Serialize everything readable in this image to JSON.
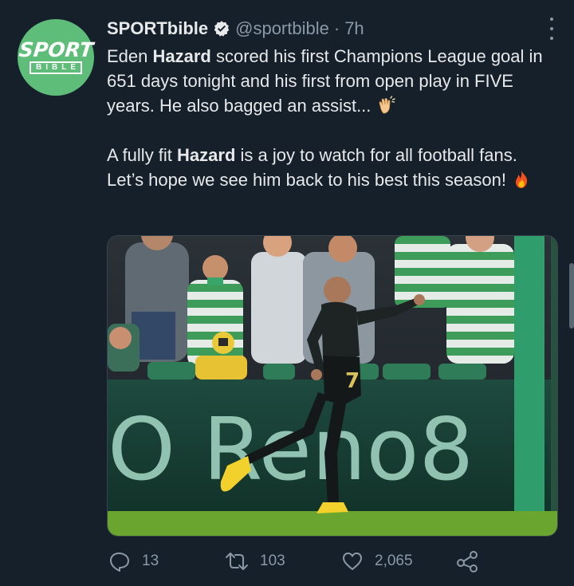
{
  "account": {
    "avatar_text_top": "SPORT",
    "avatar_text_bottom": "BIBLE",
    "name": "SPORTbible",
    "handle": "@sportbible",
    "separator": "·",
    "time": "7h"
  },
  "tweet": {
    "line1_a": "Eden ",
    "line1_b": "Hazard",
    "line1_c": " scored his first Champions League goal in 651 days tonight and his first from open play in FIVE years. He also bagged an assist...",
    "line2_a": "A fully fit ",
    "line2_b": "Hazard",
    "line2_c": " is a joy to watch for all football fans. Let’s hope we see him back to his best this season!",
    "emoji1": "clapping-hands",
    "emoji2": "fire"
  },
  "media": {
    "board_text": "O Reno8",
    "shirt_number": "7"
  },
  "actions": {
    "replies": "13",
    "retweets": "103",
    "likes": "2,065"
  },
  "colors": {
    "background": "#15202b",
    "text": "#e7e9ea",
    "secondary": "#8b98a5",
    "avatar_green": "#5ebd78",
    "verified_blue": "#1d9bf0"
  }
}
